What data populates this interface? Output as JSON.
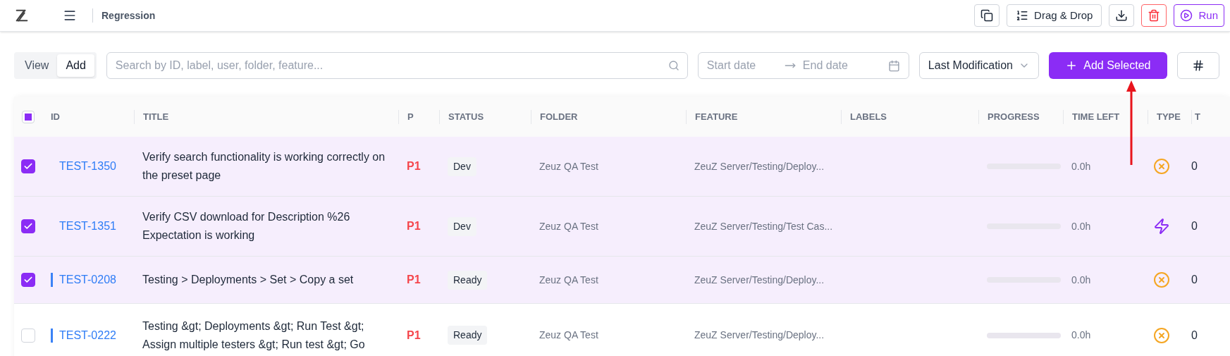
{
  "topbar": {
    "breadcrumb": "Regression",
    "actions": [
      {
        "kind": "copy"
      },
      {
        "kind": "list",
        "label": "Drag & Drop"
      },
      {
        "kind": "download"
      },
      {
        "kind": "delete"
      },
      {
        "kind": "run",
        "label": "Run"
      }
    ]
  },
  "toolbar": {
    "modes": [
      {
        "label": "View",
        "selected": false
      },
      {
        "label": "Add",
        "selected": true
      }
    ],
    "search": {
      "placeholder": "Search by ID, label, user, folder, feature..."
    },
    "date_range": {
      "start_placeholder": "Start date",
      "end_placeholder": "End date"
    },
    "sort": {
      "value": "Last Modification"
    },
    "add_button": {
      "label": "Add Selected"
    }
  },
  "table": {
    "select_all": {
      "indeterminate": true
    },
    "columns": [
      "ID",
      "TITLE",
      "P",
      "STATUS",
      "FOLDER",
      "FEATURE",
      "LABELS",
      "PROGRESS",
      "TIME LEFT",
      "TYPE",
      "T"
    ],
    "rows": [
      {
        "selected": true,
        "marked": false,
        "id": "TEST-1350",
        "title": "Verify search functionality is working correctly on the preset page",
        "priority": "P1",
        "status": "Dev",
        "folder": "Zeuz QA Test",
        "feature": "ZeuZ Server/Testing/Deploy...",
        "level": 0,
        "time_left": "0.0h",
        "kind": "cross",
        "column_12": "0"
      },
      {
        "selected": true,
        "marked": false,
        "id": "TEST-1351",
        "title": "Verify CSV download for Description %26 Expectation is working",
        "priority": "P1",
        "status": "Dev",
        "folder": "Zeuz QA Test",
        "feature": "ZeuZ Server/Testing/Test Cas...",
        "level": 0,
        "time_left": "0.0h",
        "kind": "bolt",
        "column_12": "0"
      },
      {
        "selected": true,
        "marked": true,
        "id": "TEST-0208",
        "title": "Testing > Deployments > Set > Copy a set",
        "priority": "P1",
        "status": "Ready",
        "folder": "Zeuz QA Test",
        "feature": "ZeuZ Server/Testing/Deploy...",
        "level": 0,
        "time_left": "0.0h",
        "kind": "cross",
        "column_12": "0"
      },
      {
        "selected": false,
        "marked": true,
        "id": "TEST-0222",
        "title": "Testing &gt; Deployments &gt; Run Test &gt; Assign multiple testers &gt; Run test &gt; Go",
        "priority": "P1",
        "status": "Ready",
        "folder": "Zeuz QA Test",
        "feature": "ZeuZ Server/Testing/Deploy...",
        "level": 0,
        "time_left": "0.0h",
        "kind": "cross",
        "column_12": "0"
      }
    ]
  }
}
